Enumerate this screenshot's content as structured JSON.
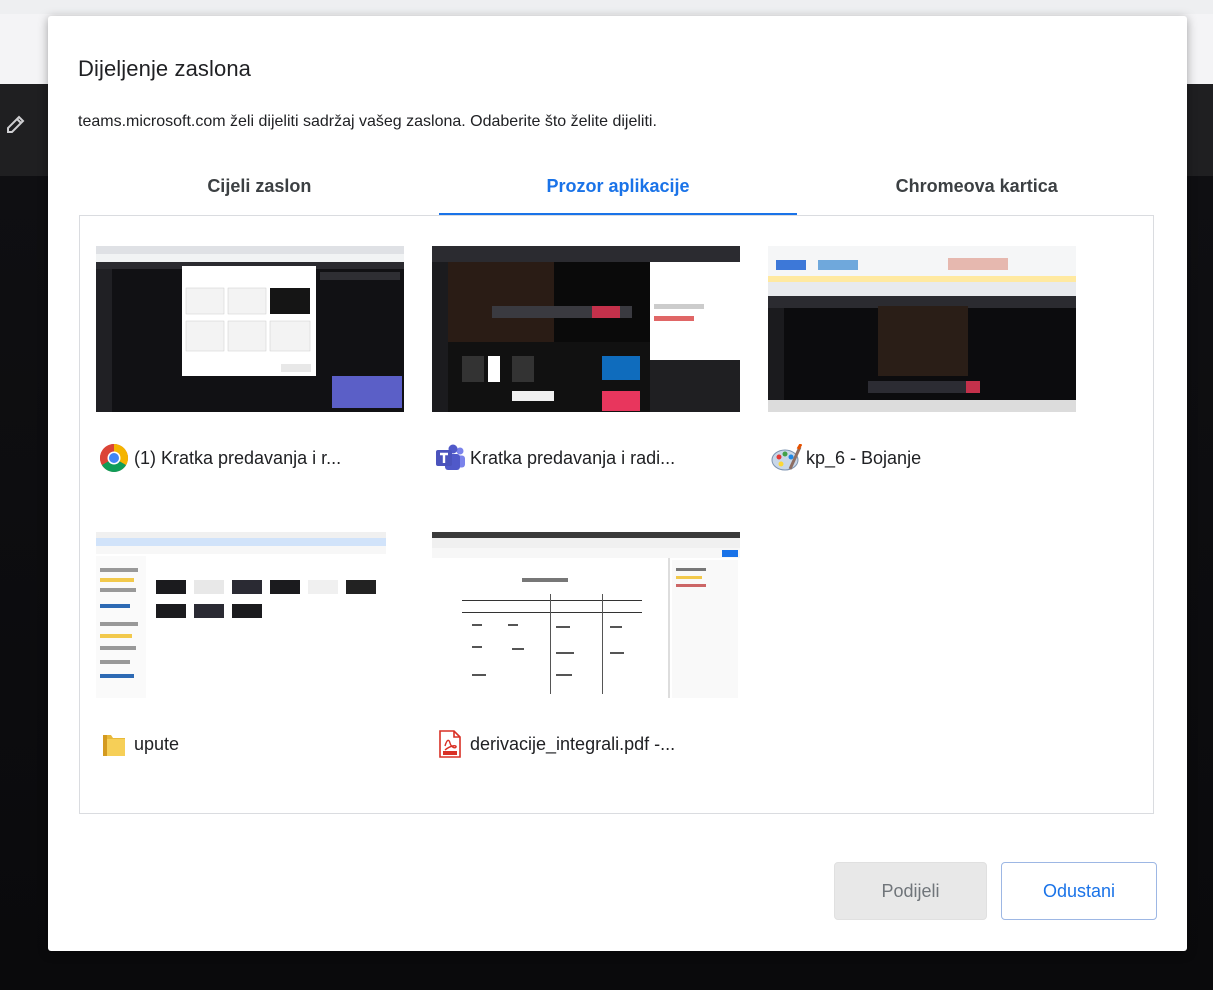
{
  "dialog": {
    "title": "Dijeljenje zaslona",
    "subtitle": "teams.microsoft.com želi dijeliti sadržaj vašeg zaslona. Odaberite što želite dijeliti."
  },
  "tabs": [
    {
      "label": "Cijeli zaslon",
      "active": false
    },
    {
      "label": "Prozor aplikacije",
      "active": true
    },
    {
      "label": "Chromeova kartica",
      "active": false
    }
  ],
  "windows": [
    {
      "label": "(1) Kratka predavanja i r...",
      "icon": "chrome-icon"
    },
    {
      "label": "Kratka predavanja i radi...",
      "icon": "teams-icon"
    },
    {
      "label": "kp_6 - Bojanje",
      "icon": "paint-icon"
    },
    {
      "label": "upute",
      "icon": "folder-icon"
    },
    {
      "label": "derivacije_integrali.pdf -...",
      "icon": "pdf-icon"
    }
  ],
  "buttons": {
    "share": "Podijeli",
    "cancel": "Odustani"
  },
  "colors": {
    "accent": "#1a73e8",
    "disabled_bg": "#e8e8e8",
    "disabled_text": "#70757a"
  }
}
